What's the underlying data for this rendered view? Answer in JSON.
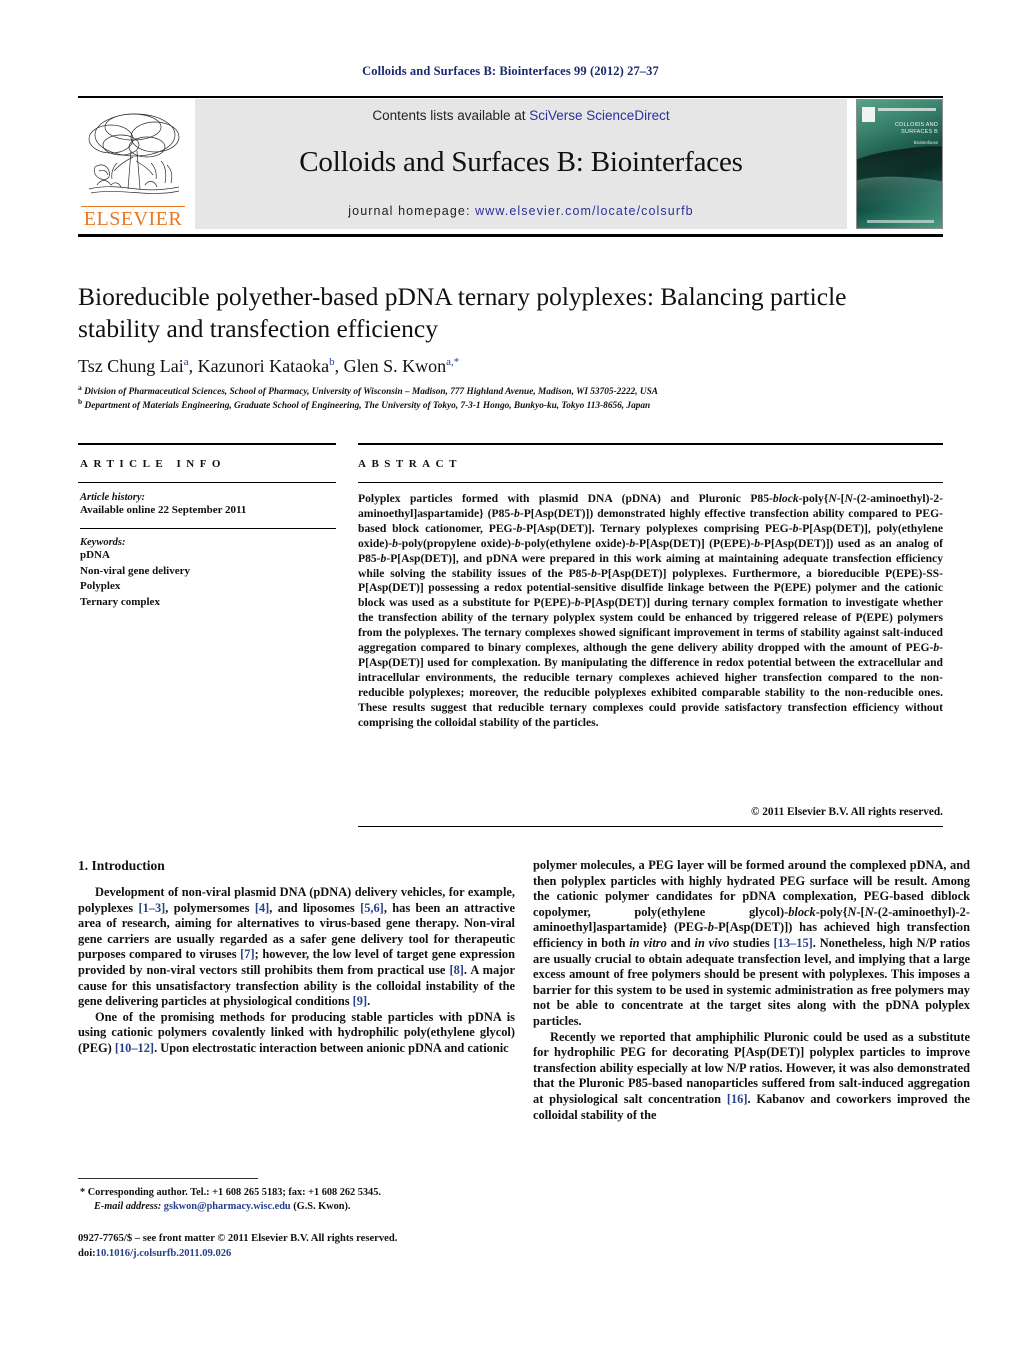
{
  "running_head": "Colloids and Surfaces B: Biointerfaces 99 (2012) 27–37",
  "banner": {
    "publisher_name": "ELSEVIER",
    "contents_prefix": "Contents lists available at ",
    "contents_link": "SciVerse ScienceDirect",
    "journal_title": "Colloids and Surfaces B: Biointerfaces",
    "homepage_prefix": "journal homepage: ",
    "homepage_url": "www.elsevier.com/locate/colsurfb",
    "cover_title": "COLLOIDS AND SURFACES B",
    "cover_subtitle": "Biointerfaces"
  },
  "article": {
    "title": "Bioreducible polyether-based pDNA ternary polyplexes: Balancing particle stability and transfection efficiency",
    "authors": "Tsz Chung Lai, Kazunori Kataoka, Glen S. Kwon",
    "affiliation_a": "Division of Pharmaceutical Sciences, School of Pharmacy, University of Wisconsin – Madison, 777 Highland Avenue, Madison, WI 53705-2222, USA",
    "affiliation_b": "Department of Materials Engineering, Graduate School of Engineering, The University of Tokyo, 7-3-1 Hongo, Bunkyo-ku, Tokyo 113-8656, Japan"
  },
  "info": {
    "heading": "ARTICLE INFO",
    "history_label": "Article history:",
    "history_value": "Available online 22 September 2011",
    "keywords_label": "Keywords:",
    "keywords": [
      "pDNA",
      "Non-viral gene delivery",
      "Polyplex",
      "Ternary complex"
    ]
  },
  "abstract": {
    "heading": "ABSTRACT",
    "copyright": "© 2011 Elsevier B.V. All rights reserved."
  },
  "introduction": {
    "heading": "1.  Introduction"
  },
  "footnote": {
    "corresponding": "* Corresponding author. Tel.: +1 608 265 5183; fax: +1 608 262 5345.",
    "email_label": "E-mail address:",
    "email": "gskwon@pharmacy.wisc.edu",
    "email_suffix": "(G.S. Kwon).",
    "issn_line": "0927-7765/$ – see front matter © 2011 Elsevier B.V. All rights reserved.",
    "doi_label": "doi:",
    "doi": "10.1016/j.colsurfb.2011.09.026"
  },
  "colors": {
    "link": "#27408b",
    "elsevier_orange": "#E87722",
    "header_navy": "#1a2a6c",
    "band_gray": "#e6e6e6"
  }
}
